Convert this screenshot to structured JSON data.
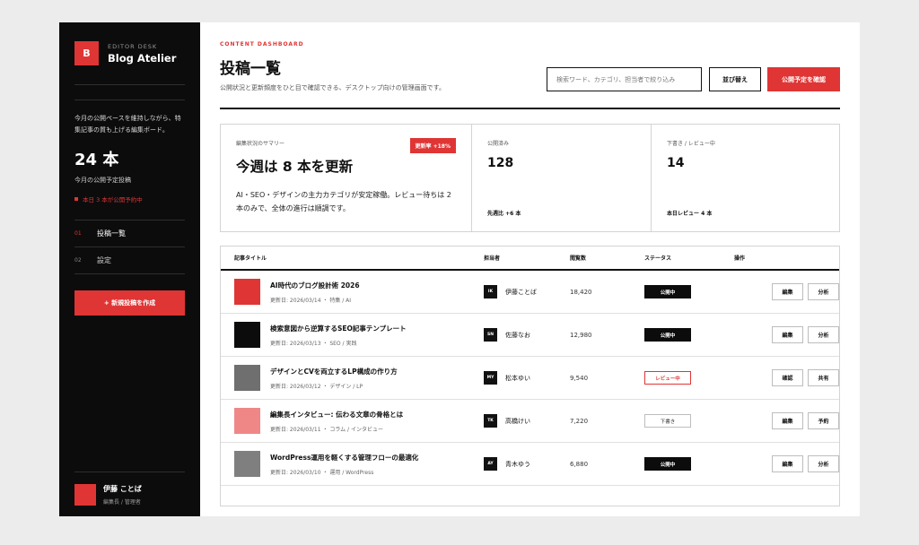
{
  "sidebar": {
    "logo_letter": "B",
    "brand_sub": "EDITOR DESK",
    "brand_title": "Blog Atelier",
    "description": "今月の公開ペースを維持しながら、特集記事の質も上げる編集ボード。",
    "count": "24 本",
    "count_label": "今月の公開予定投稿",
    "alert": "本日 3 本が公開予約中",
    "nav": [
      {
        "num": "01",
        "label": "投稿一覧"
      },
      {
        "num": "02",
        "label": "設定"
      }
    ],
    "new_post": "+ 新規投稿を作成",
    "user": {
      "name": "伊藤 ことば",
      "role": "編集長 / 管理者"
    }
  },
  "header": {
    "eyebrow": "CONTENT DASHBOARD",
    "title": "投稿一覧",
    "subtitle": "公開状況と更新頻度をひと目で確認できる、デスクトップ向けの管理画面です。",
    "search_placeholder": "検索ワード、カテゴリ、担当者で絞り込み",
    "sort_label": "並び替え",
    "schedule_label": "公開予定を確認"
  },
  "summary": {
    "main": {
      "label": "編集状況のサマリー",
      "badge": "更新率 +18%",
      "headline": "今週は 8 本を更新",
      "desc": "AI・SEO・デザインの主力カテゴリが安定稼働。レビュー待ちは 2 本のみで、全体の進行は順調です。"
    },
    "published": {
      "label": "公開済み",
      "value": "128",
      "foot": "先週比 +6 本"
    },
    "drafts": {
      "label": "下書き / レビュー中",
      "value": "14",
      "foot": "本日レビュー 4 本"
    }
  },
  "table": {
    "headers": {
      "title": "記事タイトル",
      "owner": "担当者",
      "views": "閲覧数",
      "status": "ステータス",
      "actions": "操作"
    },
    "rows": [
      {
        "title": "AI時代のブログ設計術 2026",
        "meta": "更新日: 2026/03/14 ・ 特集 / AI",
        "initials": "IK",
        "owner": "伊藤ことば",
        "views": "18,420",
        "status": "公開中",
        "status_style": "dark",
        "thumb": "#e03535",
        "actions": [
          "編集",
          "分析"
        ]
      },
      {
        "title": "検索意図から逆算するSEO記事テンプレート",
        "meta": "更新日: 2026/03/13 ・ SEO / 実践",
        "initials": "SN",
        "owner": "佐藤なお",
        "views": "12,980",
        "status": "公開中",
        "status_style": "dark",
        "thumb": "#0c0c0c",
        "actions": [
          "編集",
          "分析"
        ]
      },
      {
        "title": "デザインとCVを両立するLP構成の作り方",
        "meta": "更新日: 2026/03/12 ・ デザイン / LP",
        "initials": "MY",
        "owner": "松本ゆい",
        "views": "9,540",
        "status": "レビュー中",
        "status_style": "red",
        "thumb": "#6f6f6f",
        "actions": [
          "確認",
          "共有"
        ]
      },
      {
        "title": "編集長インタビュー: 伝わる文章の骨格とは",
        "meta": "更新日: 2026/03/11 ・ コラム / インタビュー",
        "initials": "TK",
        "owner": "高橋けい",
        "views": "7,220",
        "status": "下書き",
        "status_style": "plain",
        "thumb": "#ef8787",
        "actions": [
          "編集",
          "予約"
        ]
      },
      {
        "title": "WordPress運用を軽くする管理フローの最適化",
        "meta": "更新日: 2026/03/10 ・ 運用 / WordPress",
        "initials": "AY",
        "owner": "青木ゆう",
        "views": "6,880",
        "status": "公開中",
        "status_style": "dark",
        "thumb": "#7f7f7f",
        "actions": [
          "編集",
          "分析"
        ]
      }
    ]
  }
}
